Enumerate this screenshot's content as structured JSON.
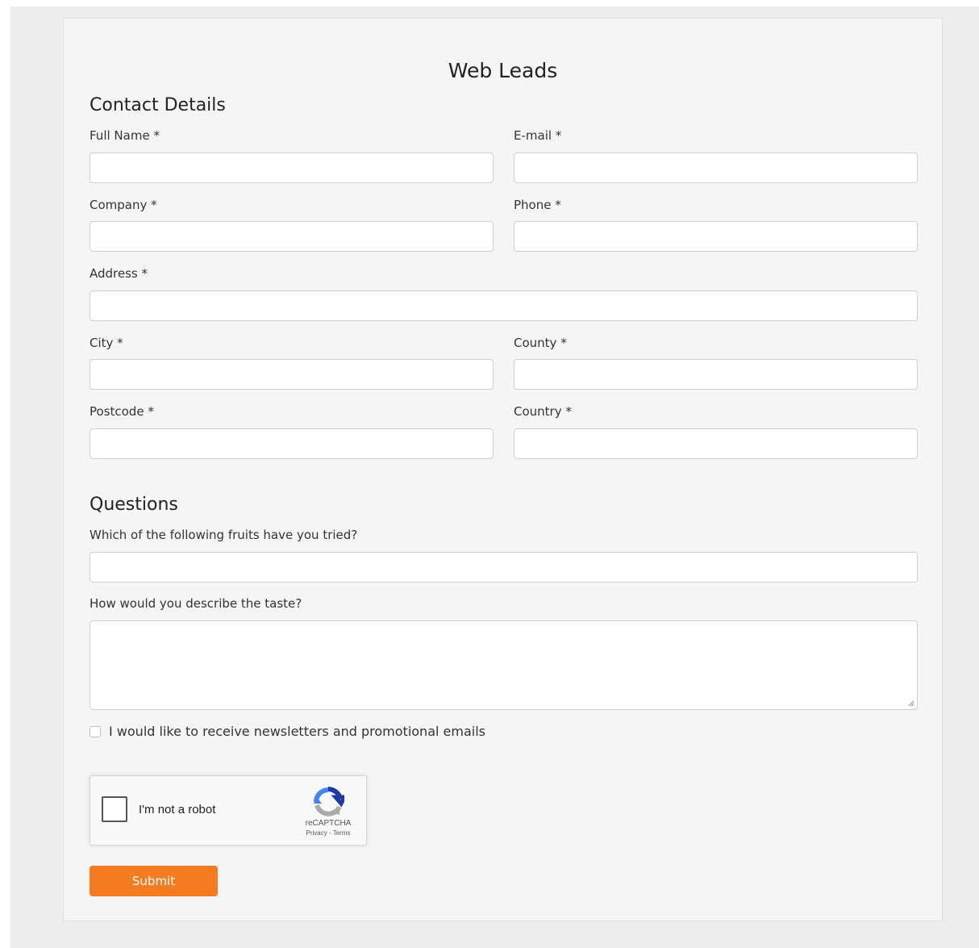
{
  "form": {
    "title": "Web Leads",
    "contact_section_title": "Contact Details",
    "questions_section_title": "Questions"
  },
  "contact": {
    "full_name_label": "Full Name *",
    "email_label": "E-mail *",
    "company_label": "Company *",
    "phone_label": "Phone *",
    "address_label": "Address *",
    "city_label": "City *",
    "county_label": "County *",
    "postcode_label": "Postcode *",
    "country_label": "Country *",
    "full_name_value": "",
    "email_value": "",
    "company_value": "",
    "phone_value": "",
    "address_value": "",
    "city_value": "",
    "county_value": "",
    "postcode_value": "",
    "country_value": ""
  },
  "questions": {
    "fruits_label": "Which of the following fruits have you tried?",
    "fruits_value": "",
    "taste_label": "How would you describe the taste?",
    "taste_value": ""
  },
  "newsletter": {
    "label": "I would like to receive newsletters and promotional emails",
    "checked": false
  },
  "captcha": {
    "label": "I'm not a robot",
    "brand": "reCAPTCHA",
    "privacy": "Privacy",
    "separator": " - ",
    "terms": "Terms"
  },
  "actions": {
    "submit_label": "Submit"
  },
  "colors": {
    "accent": "#f47b20",
    "page_background": "#ededed",
    "card_background": "#f5f5f5"
  }
}
